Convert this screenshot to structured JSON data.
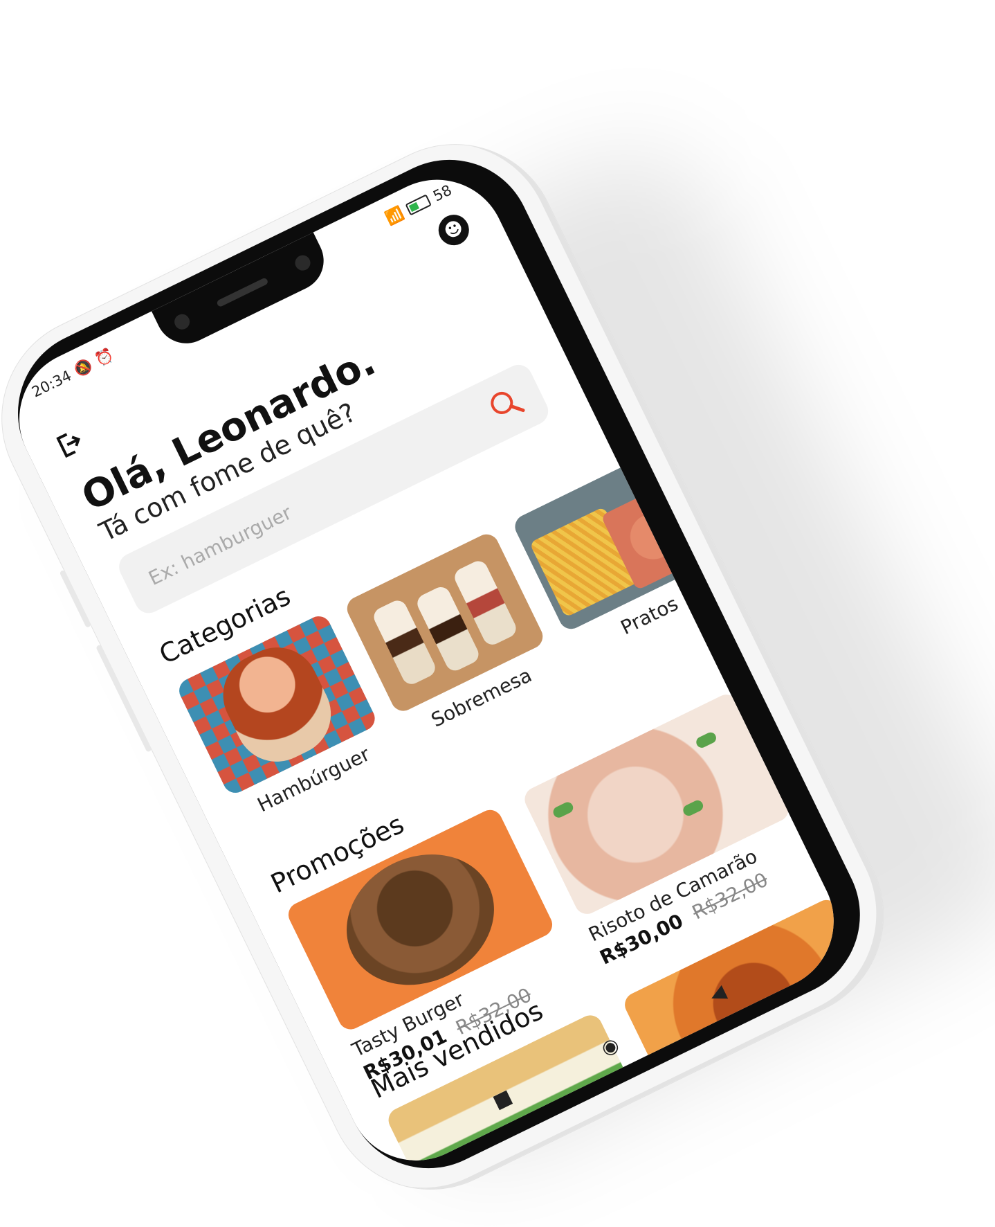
{
  "status_bar": {
    "time": "20:34",
    "battery": "58"
  },
  "header": {
    "greeting": "Olá, Leonardo.",
    "subtitle": "Tá com fome de quê?"
  },
  "search": {
    "placeholder": "Ex: hamburguer",
    "value": ""
  },
  "sections": {
    "categories_title": "Categorias",
    "promotions_title": "Promoções",
    "best_sellers_title": "Mais vendidos"
  },
  "categories": [
    {
      "label": "Hambúrguer"
    },
    {
      "label": "Sobremesa"
    },
    {
      "label": "Pratos"
    }
  ],
  "promotions": [
    {
      "name": "Tasty Burger",
      "price": "R$30,01",
      "old_price": "R$32,00"
    },
    {
      "name": "Risoto de Camarão",
      "price": "R$30,00",
      "old_price": "R$32,00"
    }
  ],
  "colors": {
    "accent": "#e8452c",
    "text": "#111111",
    "search_bg": "#f1f1f1"
  },
  "icons": {
    "exit": "exit-icon",
    "avatar": "avatar-icon",
    "search": "search-icon",
    "nav_back": "back-triangle-icon",
    "nav_home": "home-circle-icon",
    "nav_recent": "recent-square-icon"
  }
}
